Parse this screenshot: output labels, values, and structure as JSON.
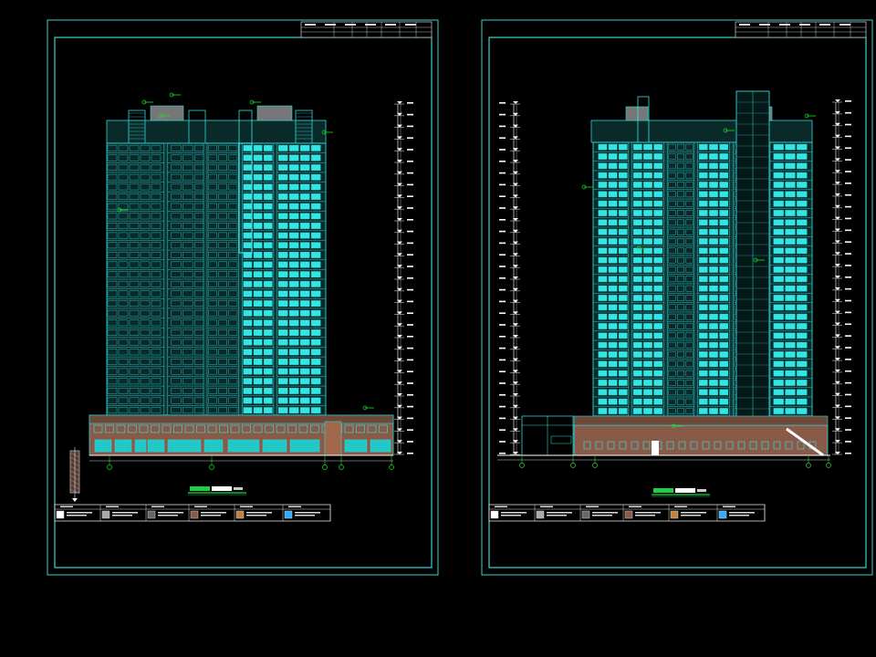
{
  "colors": {
    "background": "#000000",
    "sheet_border": "#3fd0d0",
    "building_line": "#2fd6d6",
    "building_fill": "#0a2a2a",
    "window_bright": "#33e6e6",
    "podium_fill": "#8a5a48",
    "podium_glass": "#20c8c8",
    "roof_box": "#777777",
    "annotation_green": "#22dd22",
    "dimension": "#cccccc",
    "title_green": "#22cc44"
  },
  "sheets": [
    {
      "id": "left",
      "drawing_title_icon": "elevation-title-label",
      "title_block_icon": "title-block-table",
      "legend_icon": "material-legend-table"
    },
    {
      "id": "right",
      "drawing_title_icon": "elevation-title-label",
      "title_block_icon": "title-block-table",
      "legend_icon": "material-legend-table"
    }
  ]
}
